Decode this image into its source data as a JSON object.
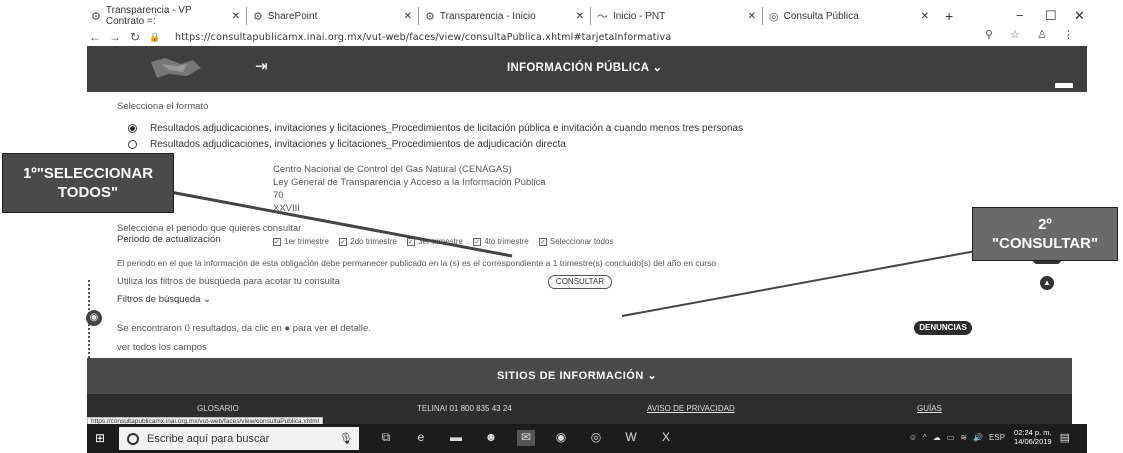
{
  "tabs": [
    {
      "title": "Transparencia - VP Contrato =:",
      "icon": "gear-icon"
    },
    {
      "title": "SharePoint",
      "icon": "gear-icon"
    },
    {
      "title": "Transparencia - Inicio",
      "icon": "gear-icon"
    },
    {
      "title": "Inicio - PNT",
      "icon": "pnt-icon"
    },
    {
      "title": "Consulta Pública",
      "icon": "chrome-icon"
    }
  ],
  "browser": {
    "url": "https://consultapublicamx.inai.org.mx/vut-web/faces/view/consultaPublica.xhtml#tarjetaInformativa"
  },
  "header": {
    "menu_label": "INFORMACIÓN PÚBLICA ⌄"
  },
  "content": {
    "format_label": "Selecciona el formato",
    "radio_options": [
      {
        "label": "Resultados adjudicaciones, invitaciones y licitaciones_Procedimientos de licitación pública e invitación a cuando menos tres personas",
        "selected": true
      },
      {
        "label": "Resultados adjudicaciones, invitaciones y licitaciones_Procedimientos de adjudicación directa",
        "selected": false
      }
    ],
    "info_lines": [
      "Centro Nacional de Control del Gas Natural (CENAGAS)",
      "Ley General de Transparencia y Acceso a la Información Pública",
      "70",
      "XXVIII"
    ],
    "period_prompt": "Selecciona el periodo que quieres consultar",
    "period_label": "Periodo de actualización",
    "periods": [
      "1er trimestre",
      "2do trimestre",
      "3er trimestre",
      "4to trimestre",
      "Seleccionar todos"
    ],
    "notice": "El periodo en el que la información de esta obligación debe permanecer publicado en la (s) es el correspondiente a 1 trimestre(s) concluido(s) del año en curso",
    "filters_hint": "Utiliza los filtros de búsqueda para acotar tu consulta",
    "consultar_button": "CONSULTAR",
    "filters_label": "Filtros de búsqueda ⌄",
    "results_text": "Se encontraron 0 resultados, da clic en ● para ver el detalle.",
    "see_all": "ver todos los campos",
    "denuncias_button": "DENUNCIAS"
  },
  "annotations": {
    "step1_line1": "1º\"SELECCIONAR",
    "step1_line2": "TODOS\"",
    "step2_line1": "2º",
    "step2_line2": "\"CONSULTAR\""
  },
  "footer": {
    "sitios_label": "SITIOS DE INFORMACIÓN ⌄",
    "glosario": "GLOSARIO",
    "telinai": "TELINAI 01 800 835 43 24",
    "aviso": "AVISO DE PRIVACIDAD",
    "guias": "GUÍAS",
    "status_url": "https://consultapublicamx.inai.org.mx/vut-web/faces/view/consultaPublica.xhtml"
  },
  "taskbar": {
    "search_placeholder": "Escribe aquí para buscar",
    "lang": "ESP",
    "time": "02:24 p. m.",
    "date": "14/06/2019"
  }
}
